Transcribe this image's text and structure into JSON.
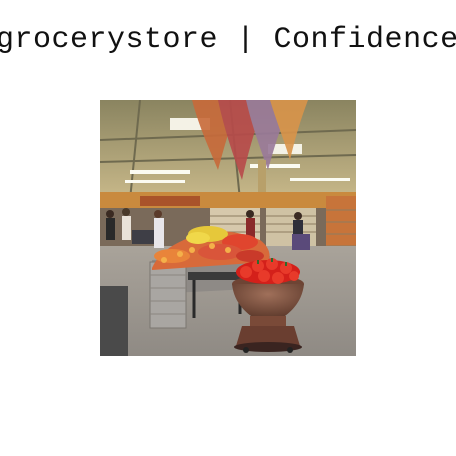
{
  "caption": {
    "text": "grocerystore | Confidence:"
  },
  "photo": {
    "subject": "grocery store interior with produce display"
  },
  "colors": {
    "background": "#ffffff",
    "caption_text": "#111111"
  }
}
